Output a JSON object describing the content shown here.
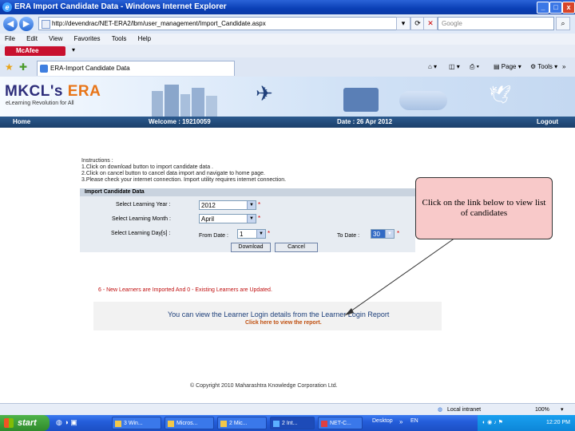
{
  "window": {
    "title": "ERA Import Candidate Data - Windows Internet Explorer",
    "controls": [
      "_",
      "□",
      "x"
    ]
  },
  "browser": {
    "address": "http://devendrac/NET-ERA2/lbm/user_management/Import_Candidate.aspx",
    "search_placeholder": "Google",
    "menu": [
      "File",
      "Edit",
      "View",
      "Favorites",
      "Tools",
      "Help"
    ],
    "mcafee": "McAfee",
    "tab_title": "ERA-Import Candidate Data",
    "commands": [
      "Page",
      "Tools"
    ]
  },
  "site": {
    "logo_prefix": "MKCL's",
    "logo_brand": "ERA",
    "tagline": "eLearning Revolution for All",
    "nav": {
      "home": "Home",
      "welcome": "Welcome : 19210059",
      "date": "Date : 26 Apr 2012",
      "logout": "Logout"
    }
  },
  "instructions": {
    "heading": "Instructions :",
    "lines": [
      "1.Click on download button to import candidate data .",
      "2.Click on cancel button to cancel data import and navigate to home page.",
      "3.Please check your internet connection. Import utility requires internet  connection."
    ]
  },
  "form": {
    "header": "Import Candidate Data",
    "learning_year_label": "Select Learning Year :",
    "learning_year_value": "2012",
    "learning_month_label": "Select Learning Month :",
    "learning_month_value": "April",
    "learning_days_label": "Select Learning Day[s] :",
    "from_label": "From Date :",
    "from_value": "1",
    "to_label": "To Date :",
    "to_value": "30",
    "required_mark": "*",
    "download_button": "Download",
    "cancel_button": "Cancel"
  },
  "result": {
    "message": "6 - New Learners are Imported And 0 - Existing Learners are Updated.",
    "report_text": "You can view the Learner Login details from the Learner Login Report",
    "report_link": "Click here to view the report."
  },
  "footer": {
    "copyright": "© Copyright 2010 Maharashtra Knowledge Corporation Ltd."
  },
  "callout": {
    "text": "Click on the link below to view list of candidates"
  },
  "statusbar": {
    "zone": "Local intranet",
    "zoom": "100%"
  },
  "taskbar": {
    "start": "start",
    "tasks": [
      "3 Win...",
      "Micros...",
      "2 Mic...",
      "2 Int...",
      "NET-C...",
      "Desktop"
    ],
    "language": "EN",
    "clock": "12:20 PM"
  },
  "colors": {
    "nav_bar": "#1b3f6a",
    "message_red": "#c01010",
    "link_orange": "#c05010",
    "callout_fill": "#f8c9c9",
    "taskbar_blue": "#245edb"
  }
}
